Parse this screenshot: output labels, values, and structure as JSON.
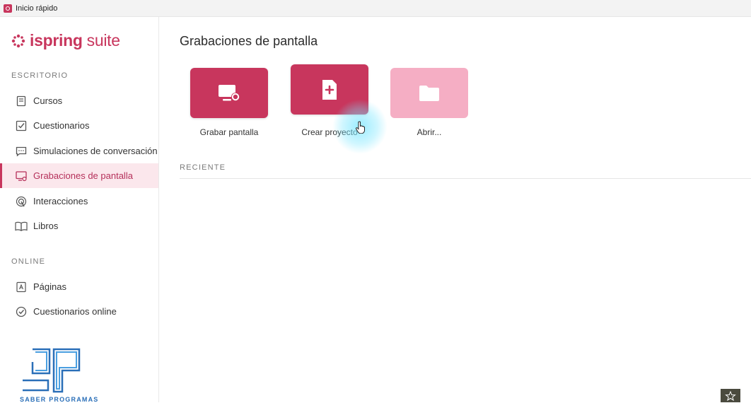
{
  "window": {
    "title": "Inicio rápido"
  },
  "brand": {
    "name_part1": "ispring",
    "name_part2": "suite",
    "accent": "#c8365d"
  },
  "sidebar": {
    "sections": [
      {
        "label": "ESCRITORIO",
        "items": [
          {
            "label": "Cursos",
            "icon": "book-icon",
            "active": false
          },
          {
            "label": "Cuestionarios",
            "icon": "checkbox-icon",
            "active": false
          },
          {
            "label": "Simulaciones de conversación",
            "icon": "chat-icon",
            "active": false
          },
          {
            "label": "Grabaciones de pantalla",
            "icon": "screen-record-icon",
            "active": true
          },
          {
            "label": "Interacciones",
            "icon": "touch-icon",
            "active": false
          },
          {
            "label": "Libros",
            "icon": "open-book-icon",
            "active": false
          }
        ]
      },
      {
        "label": "ONLINE",
        "items": [
          {
            "label": "Páginas",
            "icon": "page-icon",
            "active": false
          },
          {
            "label": "Cuestionarios online",
            "icon": "check-circle-icon",
            "active": false
          }
        ]
      }
    ],
    "watermark": "SABER PROGRAMAS"
  },
  "main": {
    "title": "Grabaciones de pantalla",
    "actions": [
      {
        "label": "Grabar pantalla",
        "icon": "record-screen-icon",
        "style": "primary"
      },
      {
        "label": "Crear proyecto",
        "icon": "new-file-icon",
        "style": "primary"
      },
      {
        "label": "Abrir...",
        "icon": "folder-icon",
        "style": "light"
      }
    ],
    "recent_label": "RECIENTE"
  }
}
